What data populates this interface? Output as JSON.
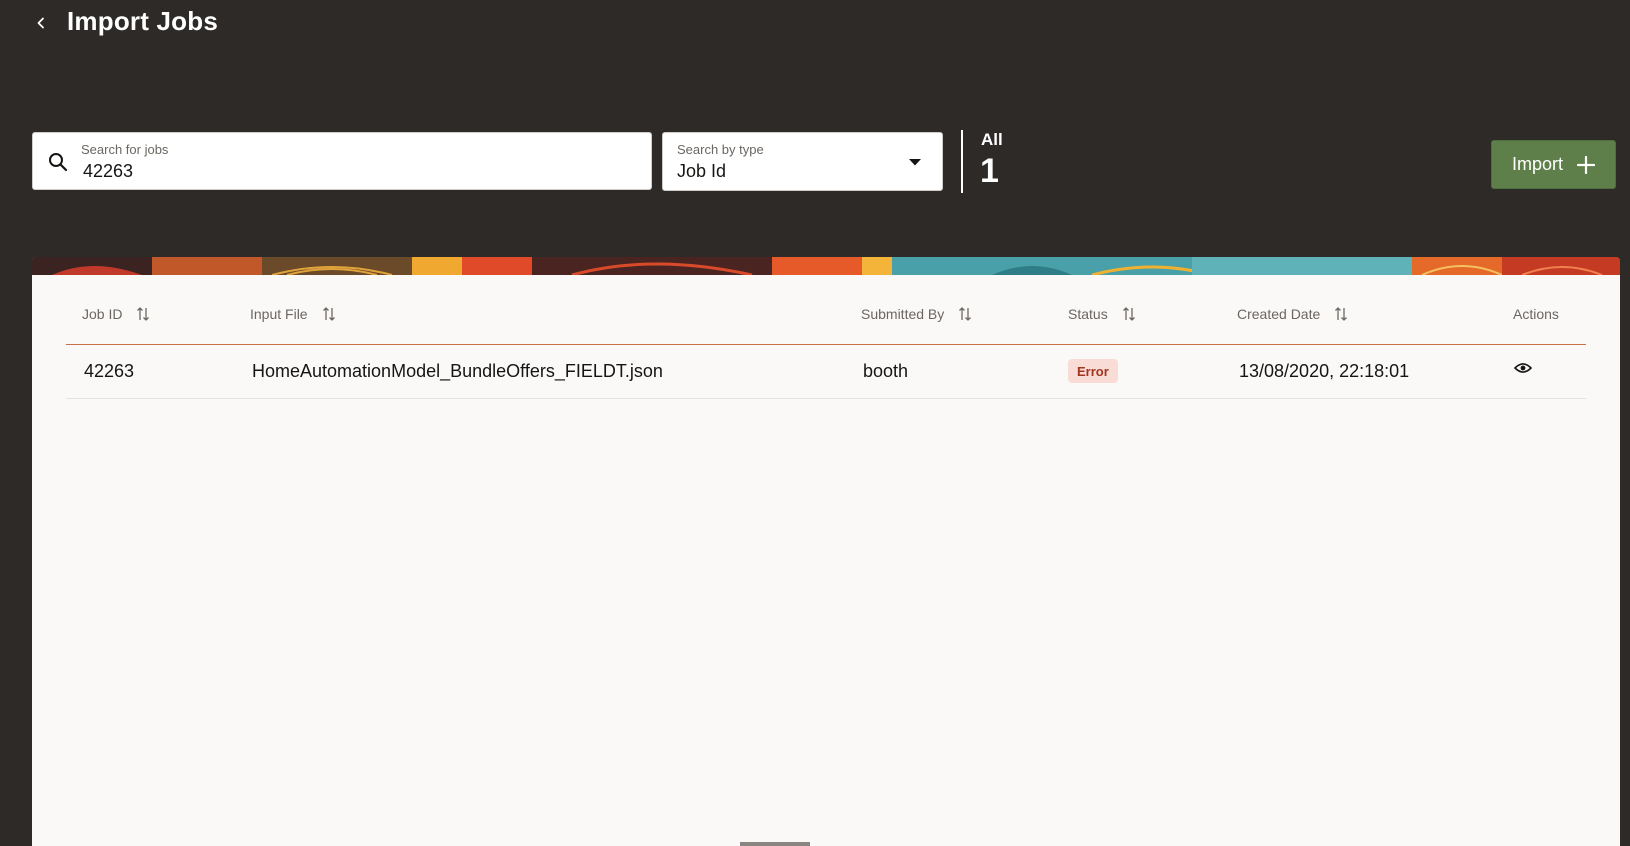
{
  "header": {
    "title": "Import Jobs"
  },
  "search": {
    "label": "Search for jobs",
    "value": "42263"
  },
  "type_filter": {
    "label": "Search by type",
    "value": "Job Id"
  },
  "count": {
    "label": "All",
    "value": "1"
  },
  "import_button": {
    "label": "Import"
  },
  "table": {
    "columns": [
      {
        "label": "Job ID",
        "sortable": true
      },
      {
        "label": "Input File",
        "sortable": true
      },
      {
        "label": "Submitted By",
        "sortable": true
      },
      {
        "label": "Status",
        "sortable": true
      },
      {
        "label": "Created Date",
        "sortable": true
      },
      {
        "label": "Actions",
        "sortable": false
      }
    ],
    "rows": [
      {
        "job_id": "42263",
        "input_file": "HomeAutomationModel_BundleOffers_FIELDT.json",
        "submitted_by": "booth",
        "status": "Error",
        "created_date": "13/08/2020, 22:18:01",
        "action_icon": "eye-icon"
      }
    ]
  },
  "colors": {
    "background": "#2e2a28",
    "panel": "#fbf9f8",
    "import_button": "#5e7f4a",
    "header_divider": "#c8704a",
    "error_badge_bg": "#f9dcd5",
    "error_badge_text": "#a1351f"
  },
  "icons": {
    "back": "chevron-left-icon",
    "search": "search-icon",
    "dropdown": "caret-down-icon",
    "import": "plus-icon",
    "sort": "sort-icon",
    "view": "eye-icon"
  }
}
